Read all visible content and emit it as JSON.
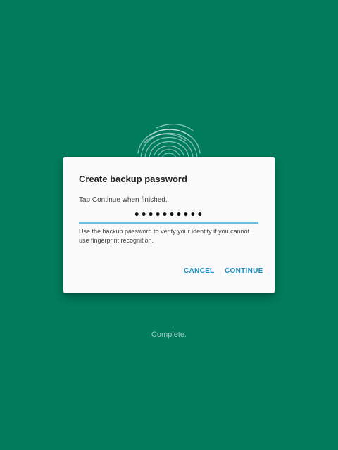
{
  "colors": {
    "background": "#007c5d",
    "dialog": "#fafafa",
    "accent": "#1a91c4",
    "field_underline": "#6cc0d9"
  },
  "background_icon": "fingerprint-icon",
  "dialog": {
    "title": "Create backup password",
    "message": "Tap Continue when finished.",
    "password_value": "••••••••••",
    "help_text": "Use the backup password to verify your identity if you cannot use fingerprint recognition.",
    "cancel_label": "CANCEL",
    "continue_label": "CONTINUE"
  },
  "status_text": "Complete."
}
